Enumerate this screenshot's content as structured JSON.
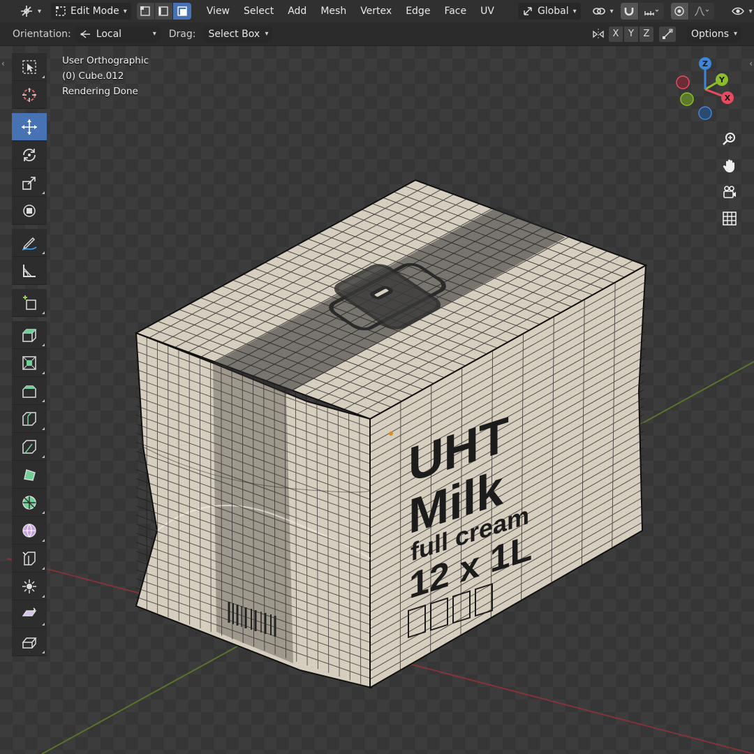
{
  "header": {
    "mode_label": "Edit Mode",
    "menu": [
      "View",
      "Select",
      "Add",
      "Mesh",
      "Vertex",
      "Edge",
      "Face",
      "UV"
    ],
    "transform_orientation": "Global"
  },
  "tool_settings": {
    "orientation_label": "Orientation:",
    "orientation_value": "Local",
    "drag_label": "Drag:",
    "drag_value": "Select Box",
    "axis_x": "X",
    "axis_y": "Y",
    "axis_z": "Z",
    "options_label": "Options"
  },
  "viewport": {
    "view_name": "User Orthographic",
    "object_name": "(0) Cube.012",
    "status": "Rendering Done"
  },
  "package_text": {
    "line1": "UHT",
    "line2": "Milk",
    "line3": "full cream",
    "line4": "12 x 1L"
  },
  "gizmo": {
    "x": "X",
    "y": "Y",
    "z": "Z"
  },
  "colors": {
    "accent": "#4772b3",
    "axis_x": "#e84a5f",
    "axis_y": "#8cbc2a",
    "axis_z": "#3f86d8",
    "box_face": "#d8d0c3",
    "wire": "#1a1a1a"
  },
  "tools": [
    "select-box-tool",
    "cursor-tool",
    "move-tool",
    "rotate-tool",
    "scale-tool",
    "transform-tool",
    "annotate-tool",
    "measure-tool",
    "add-cube-tool",
    "extrude-region-tool",
    "inset-faces-tool",
    "bevel-tool",
    "loop-cut-tool",
    "knife-tool",
    "poly-build-tool",
    "spin-tool",
    "smooth-tool",
    "edge-slide-tool",
    "shrink-fatten-tool",
    "shear-tool",
    "rip-region-tool"
  ]
}
